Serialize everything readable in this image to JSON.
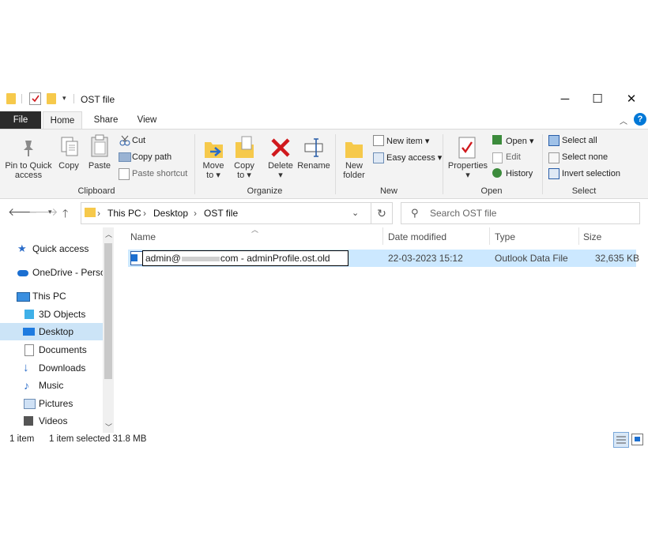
{
  "window": {
    "title": "OST file"
  },
  "tabs": {
    "file": "File",
    "home": "Home",
    "share": "Share",
    "view": "View"
  },
  "ribbon": {
    "clipboard": {
      "pin": "Pin to Quick\naccess",
      "copy": "Copy",
      "paste": "Paste",
      "cut": "Cut",
      "copy_path": "Copy path",
      "paste_shortcut": "Paste shortcut",
      "group": "Clipboard"
    },
    "organize": {
      "move_to": "Move\nto ▾",
      "copy_to": "Copy\nto ▾",
      "delete": "Delete\n▾",
      "rename": "Rename",
      "group": "Organize"
    },
    "new": {
      "new_folder": "New\nfolder",
      "new_item": "New item ▾",
      "easy_access": "Easy access ▾",
      "group": "New"
    },
    "open": {
      "properties": "Properties\n▾",
      "open": "Open ▾",
      "edit": "Edit",
      "history": "History",
      "group": "Open"
    },
    "select": {
      "select_all": "Select all",
      "select_none": "Select none",
      "invert": "Invert selection",
      "group": "Select"
    }
  },
  "address": {
    "crumbs": [
      "This PC",
      "Desktop",
      "OST file"
    ],
    "search_placeholder": "Search OST file"
  },
  "nav": {
    "quick_access": "Quick access",
    "onedrive": "OneDrive - Person",
    "this_pc": "This PC",
    "objects3d": "3D Objects",
    "desktop": "Desktop",
    "documents": "Documents",
    "downloads": "Downloads",
    "music": "Music",
    "pictures": "Pictures",
    "videos": "Videos"
  },
  "columns": {
    "name": "Name",
    "date": "Date modified",
    "type": "Type",
    "size": "Size"
  },
  "file": {
    "name_prefix": "admin@",
    "name_suffix": "com - adminProfile.ost.old",
    "date": "22-03-2023 15:12",
    "type": "Outlook Data File",
    "size": "32,635 KB"
  },
  "status": {
    "count": "1 item",
    "selected": "1 item selected  31.8 MB"
  },
  "colors": {
    "selection": "#cce8ff",
    "nav_selected": "#cce4f7",
    "accent": "#0078d7",
    "folder": "#f6c94b",
    "delete": "#d0181c"
  }
}
